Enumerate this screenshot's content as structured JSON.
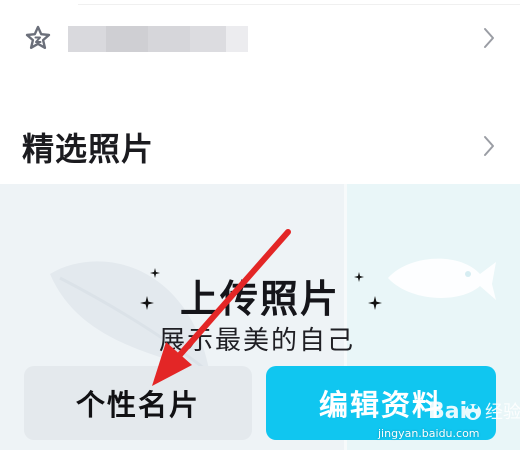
{
  "list": {
    "row1": {
      "icon": "star-badge-icon",
      "name_blurred": true,
      "chevron": "chevron-right-icon"
    },
    "row2": {
      "label": "精选照片",
      "chevron": "chevron-right-icon"
    }
  },
  "upload_card": {
    "title": "上传照片",
    "subtitle": "展示最美的自己"
  },
  "buttons": {
    "profile_card": "个性名片",
    "edit_profile": "编辑资料"
  },
  "watermark": {
    "brand": "Baidu 经验",
    "url": "jingyan.baidu.com"
  },
  "colors": {
    "accent": "#10c6f0",
    "arrow": "#e32626",
    "card_bg": "#eef3f6",
    "secondary_button_bg": "#e4e9ed"
  }
}
